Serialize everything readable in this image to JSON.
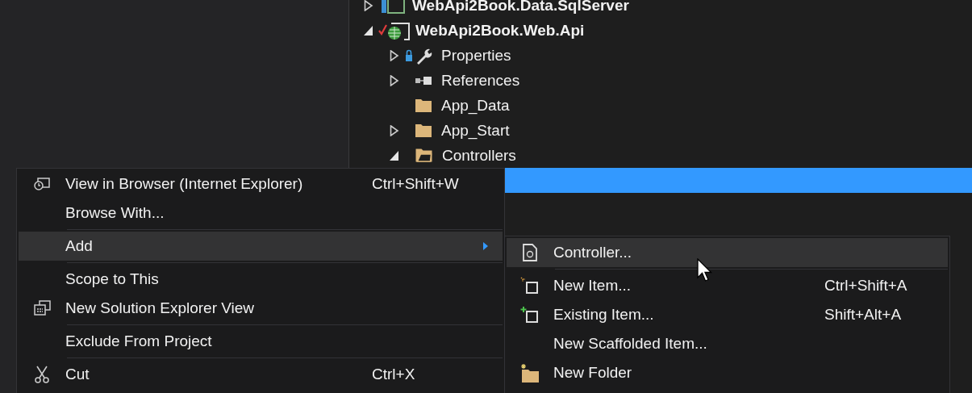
{
  "solution_explorer": {
    "tree": [
      {
        "label": "WebApi2Book.Data.SqlServer",
        "kind": "project-cut",
        "expanded": false,
        "selected": false
      },
      {
        "label": "WebApi2Book.Web.Api",
        "kind": "project",
        "expanded": true,
        "selected": false,
        "children": [
          {
            "label": "Properties",
            "kind": "properties",
            "expanded": false,
            "selected": false
          },
          {
            "label": "References",
            "kind": "references",
            "expanded": false,
            "selected": false
          },
          {
            "label": "App_Data",
            "kind": "leaf-folder",
            "selected": false
          },
          {
            "label": "App_Start",
            "kind": "folder",
            "expanded": false,
            "selected": false
          },
          {
            "label": "Controllers",
            "kind": "folder-open",
            "expanded": true,
            "selected": false
          },
          {
            "kind": "hidden-row",
            "selected": true
          }
        ]
      }
    ]
  },
  "context_menu": {
    "items": [
      {
        "kind": "browser",
        "label": "View in Browser (Internet Explorer)",
        "shortcut": "Ctrl+Shift+W",
        "highlighted": false,
        "submenu": false
      },
      {
        "kind": "plain",
        "label": "Browse With...",
        "highlighted": false,
        "submenu": false
      },
      {
        "kind": "separator"
      },
      {
        "kind": "plain",
        "label": "Add",
        "highlighted": true,
        "submenu": true
      },
      {
        "kind": "separator"
      },
      {
        "kind": "plain",
        "label": "Scope to This",
        "highlighted": false,
        "submenu": false
      },
      {
        "kind": "windows",
        "label": "New Solution Explorer View",
        "highlighted": false,
        "submenu": false
      },
      {
        "kind": "separator"
      },
      {
        "kind": "plain",
        "label": "Exclude From Project",
        "highlighted": false,
        "submenu": false
      },
      {
        "kind": "separator"
      },
      {
        "kind": "scissors",
        "label": "Cut",
        "shortcut": "Ctrl+X",
        "highlighted": false,
        "submenu": false
      }
    ]
  },
  "add_submenu": {
    "items": [
      {
        "kind": "controller",
        "label": "Controller...",
        "highlighted": true,
        "submenu": false
      },
      {
        "kind": "separator"
      },
      {
        "kind": "new-item",
        "label": "New Item...",
        "shortcut": "Ctrl+Shift+A",
        "highlighted": false,
        "submenu": false
      },
      {
        "kind": "existing-item",
        "label": "Existing Item...",
        "shortcut": "Shift+Alt+A",
        "highlighted": false,
        "submenu": false
      },
      {
        "kind": "plain",
        "label": "New Scaffolded Item...",
        "highlighted": false,
        "submenu": false
      },
      {
        "kind": "new-folder",
        "label": "New Folder",
        "highlighted": false,
        "submenu": false
      }
    ]
  }
}
